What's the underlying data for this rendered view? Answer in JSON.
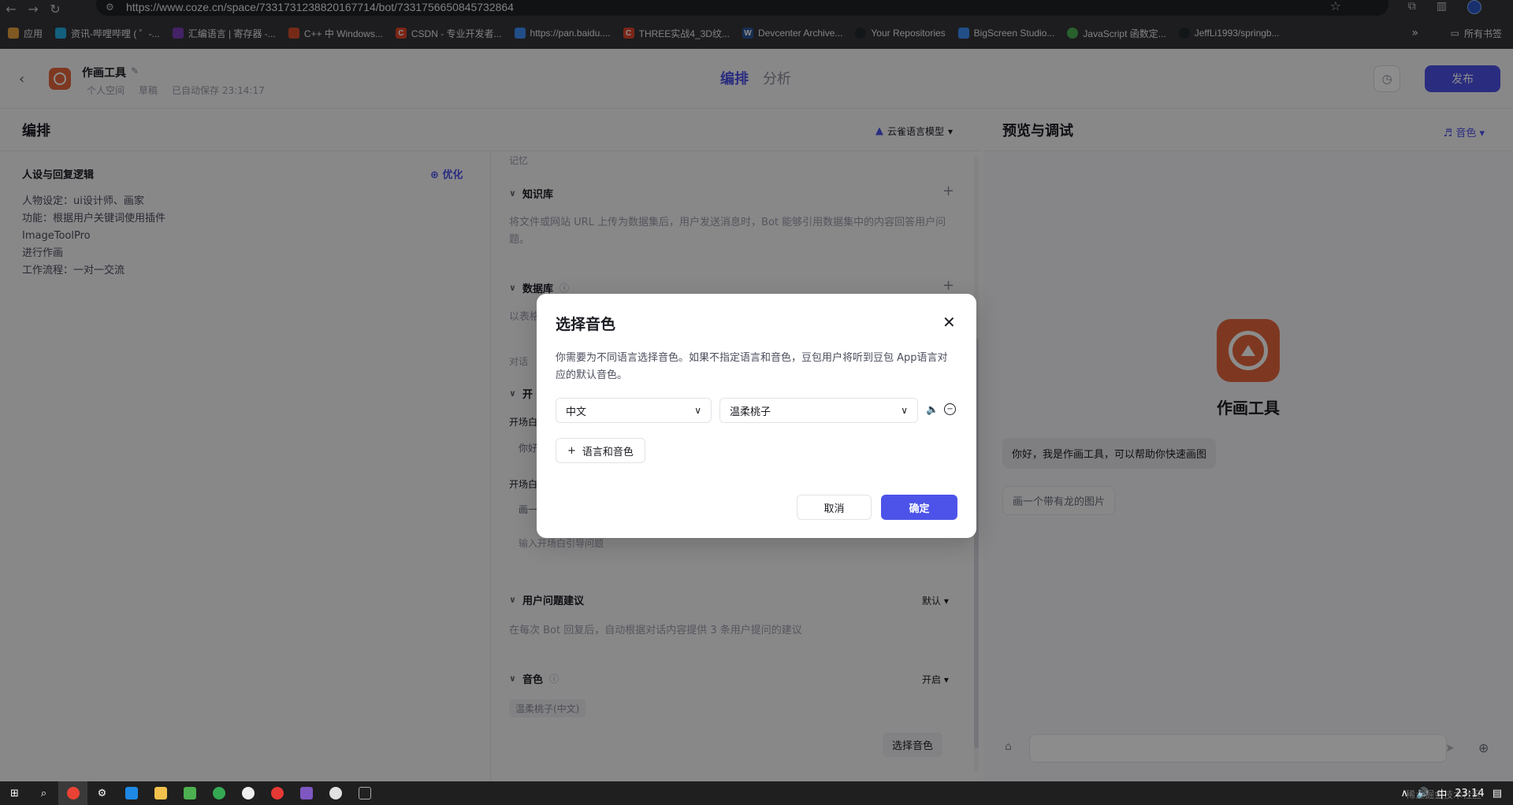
{
  "browser": {
    "url": "https://www.coze.cn/space/7331731238820167714/bot/7331756650845732864",
    "bookmarks": [
      {
        "label": "应用",
        "color": "#e8a33d"
      },
      {
        "label": "资讯-哔哩哔哩 ( ゜-...",
        "color": "#23ade5"
      },
      {
        "label": "汇编语言 | 寄存器 -...",
        "color": "#7b3fb8"
      },
      {
        "label": "C++ 中 Windows...",
        "color": "#d54d2c"
      },
      {
        "label": "CSDN - 专业开发者...",
        "color": "#e0442b"
      },
      {
        "label": "https://pan.baidu....",
        "color": "#3e8ef7"
      },
      {
        "label": "THREE实战4_3D纹...",
        "color": "#e0442b"
      },
      {
        "label": "Devcenter Archive...",
        "color": "#2b579a"
      },
      {
        "label": "Your Repositories",
        "color": "#24292f"
      },
      {
        "label": "BigScreen Studio...",
        "color": "#3e8ef7"
      },
      {
        "label": "JavaScript 函数定...",
        "color": "#4caf50"
      },
      {
        "label": "JeffLi1993/springb...",
        "color": "#24292f"
      }
    ],
    "bookmarks_all": "所有书签"
  },
  "header": {
    "bot_name": "作画工具",
    "meta": [
      "个人空间",
      "草稿",
      "已自动保存 23:14:17"
    ],
    "tabs": [
      "编排",
      "分析"
    ],
    "publish": "发布"
  },
  "arrange": {
    "title": "编排",
    "model": "云雀语言模型"
  },
  "persona": {
    "title": "人设与回复逻辑",
    "optimize": "优化",
    "lines": [
      "人物设定：ui设计师、画家",
      "功能：根据用户关键词使用插件",
      "ImageToolPro",
      "进行作画",
      "工作流程：一对一交流"
    ]
  },
  "skills": {
    "memory": "记忆",
    "knowledge_title": "知识库",
    "knowledge_desc": "将文件或网站 URL 上传为数据集后，用户发送消息时，Bot 能够引用数据集中的内容回答用户问题。",
    "database_title": "数据库",
    "database_desc": "以表格",
    "dialog_label": "对话",
    "opening_title": "开",
    "opening_label1": "开场白",
    "opening_text": "你好",
    "opening_label2": "开场白",
    "opening_q": "画一",
    "opening_placeholder": "输入开场白引导问题",
    "suggest_title": "用户问题建议",
    "suggest_mode": "默认",
    "suggest_desc": "在每次 Bot 回复后，自动根据对话内容提供 3 条用户提问的建议",
    "voice_title": "音色",
    "voice_mode": "开启",
    "voice_chip": "温柔桃子(中文)",
    "choose_voice": "选择音色"
  },
  "preview": {
    "title": "预览与调试",
    "voice_link": "音色",
    "bot_title": "作画工具",
    "greeting": "你好，我是作画工具，可以帮助你快速画图",
    "suggestion": "画一个带有龙的图片"
  },
  "modal": {
    "title": "选择音色",
    "desc": "你需要为不同语言选择音色。如果不指定语言和音色，豆包用户将听到豆包 App语言对应的默认音色。",
    "language": "中文",
    "voice": "温柔桃子",
    "add_label": "语言和音色",
    "cancel": "取消",
    "ok": "确定"
  },
  "taskbar": {
    "ime": "中",
    "time": "23:14",
    "watermark": "稀土掘金技术社区"
  }
}
